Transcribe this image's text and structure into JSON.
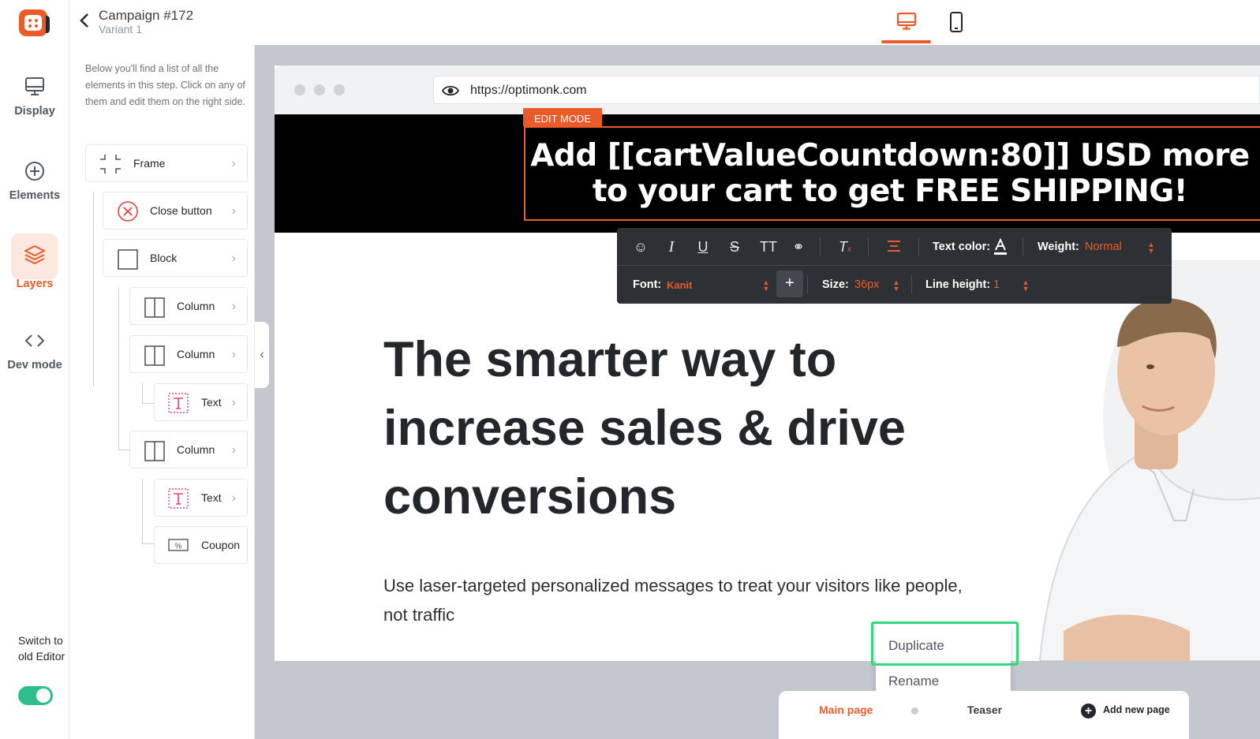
{
  "app": {
    "campaign_title": "Campaign #172",
    "variant_label": "Variant 1"
  },
  "rail": {
    "items": [
      {
        "label": "Display",
        "icon": "monitor-icon",
        "active": false
      },
      {
        "label": "Elements",
        "icon": "plus-circle-icon",
        "active": false
      },
      {
        "label": "Layers",
        "icon": "layers-icon",
        "active": true
      },
      {
        "label": "Dev mode",
        "icon": "code-icon",
        "active": false
      }
    ],
    "switch_label": "Switch to old Editor",
    "switch_on": true
  },
  "devices": {
    "active": "desktop"
  },
  "layers": {
    "description": "Below you'll find a list of all the elements in this step. Click on any of them and edit them on the right side.",
    "items": [
      {
        "label": "Frame",
        "icon": "frame-icon"
      },
      {
        "label": "Close button",
        "icon": "close-circle-icon"
      },
      {
        "label": "Block",
        "icon": "block-icon"
      },
      {
        "label": "Column",
        "icon": "column-icon"
      },
      {
        "label": "Column",
        "icon": "column-icon"
      },
      {
        "label": "Text",
        "icon": "text-icon"
      },
      {
        "label": "Column",
        "icon": "column-icon"
      },
      {
        "label": "Text",
        "icon": "text-icon"
      },
      {
        "label": "Coupon",
        "icon": "coupon-icon"
      }
    ]
  },
  "preview": {
    "url": "https://optimonk.com",
    "edit_tab": "EDIT MODE",
    "banner_text": "Add [[cartValueCountdown:80]] USD more to your cart to get FREE SHIPPING!",
    "hero_heading": "The smarter way to increase sales & drive conversions",
    "hero_subtext": "Use laser-targeted personalized messages to treat your visitors like people, not traffic"
  },
  "toolbar": {
    "text_color_label": "Text color:",
    "weight_label": "Weight:",
    "weight_value": "Normal",
    "font_label": "Font:",
    "font_value": "Kanit",
    "size_label": "Size:",
    "size_value": "36px",
    "line_height_label": "Line height:",
    "line_height_value": "1"
  },
  "context_menu": {
    "items": [
      "Duplicate",
      "Rename"
    ],
    "highlighted": "Duplicate"
  },
  "pages": {
    "main_page": "Main page",
    "teaser": "Teaser",
    "add_new_page": "Add new page"
  },
  "colors": {
    "accent": "#ed5a29",
    "toolbar_bg": "#2d3035",
    "canvas_bg": "#c3c7ce",
    "toggle_on": "#2dbe8c",
    "highlight": "#36d67d"
  }
}
